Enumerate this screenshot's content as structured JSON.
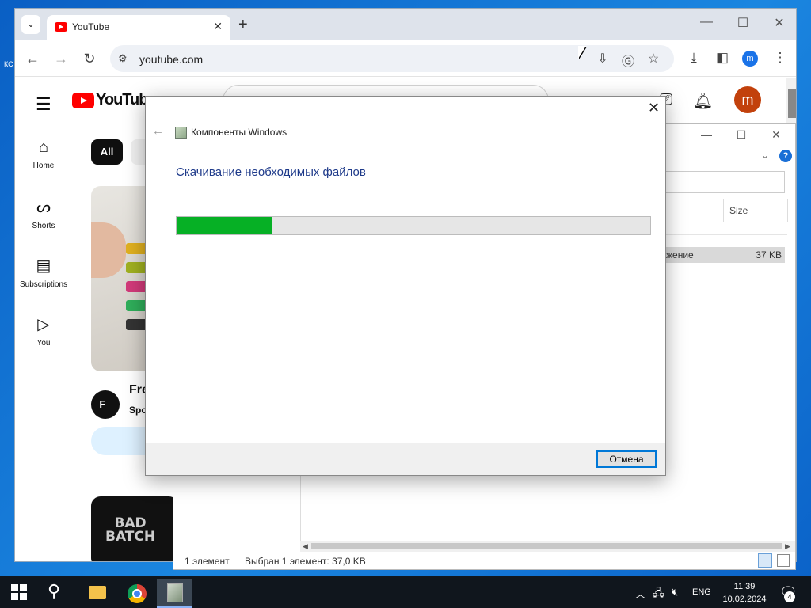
{
  "desktop": {
    "edge_label": "КС"
  },
  "browser": {
    "tab_title": "YouTube",
    "tab_menu_icon": "chevron-down-icon",
    "url": "youtube.com",
    "profile_initial": "m",
    "window_controls": {
      "minimize": "—",
      "maximize": "☐",
      "close": "✕"
    }
  },
  "youtube": {
    "logo_text": "YouTube",
    "sidebar": [
      {
        "label": "Home",
        "icon": "home-icon",
        "glyph": "⌂"
      },
      {
        "label": "Shorts",
        "icon": "shorts-icon",
        "glyph": "ᔕ"
      },
      {
        "label": "Subscriptions",
        "icon": "subscriptions-icon",
        "glyph": "▤"
      },
      {
        "label": "You",
        "icon": "you-icon",
        "glyph": "▷"
      }
    ],
    "chips": [
      "All"
    ],
    "video": {
      "avatar": "F_",
      "title": "Fre",
      "channel": "Spo"
    },
    "thumb2_text": "BAD\nBATCH",
    "avatar_initial": "m"
  },
  "explorer": {
    "column_size": "Size",
    "row_type": "жение",
    "row_size": "37 KB",
    "status_count": "1 элемент",
    "status_selected": "Выбран 1 элемент: 37,0 KB"
  },
  "dialog": {
    "app_title": "Компоненты Windows",
    "heading": "Скачивание необходимых файлов",
    "progress": 0.2,
    "cancel_label": "Отмена"
  },
  "taskbar": {
    "lang": "ENG",
    "time": "11:39",
    "date": "10.02.2024",
    "notifications": "4"
  },
  "colors": {
    "progress_fill": "#06b025",
    "youtube_red": "#ff0000",
    "dialog_heading": "#1e3a8a",
    "taskbar": "#10161d"
  }
}
